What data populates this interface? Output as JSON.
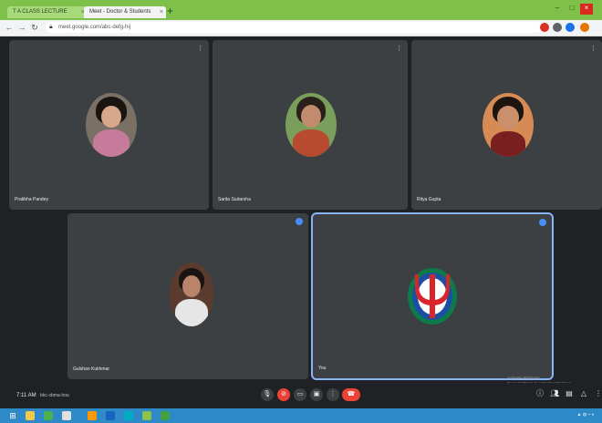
{
  "browser": {
    "tabs": [
      {
        "label": "T A CLASS LECTURE",
        "active": false
      },
      {
        "label": "Meet - Doctor & Students",
        "active": true
      }
    ],
    "url": "meet.google.com/abc-defg-hij"
  },
  "meeting": {
    "participants": [
      {
        "name": "Pratibha Pandey",
        "slot": "top-left"
      },
      {
        "name": "Sarita Sudarsha",
        "slot": "top-middle"
      },
      {
        "name": "Ritya Gupta",
        "slot": "top-right"
      },
      {
        "name": "Gulshan Kukhmar",
        "slot": "bottom-left"
      },
      {
        "name": "You",
        "slot": "bottom-right"
      }
    ],
    "time": "7:11 AM",
    "meeting_code": "bkc-xbma-hou",
    "activation_notice": [
      "Activate Windows",
      "Go to Settings to activate Windows."
    ]
  },
  "icons": {
    "more": "more-vert-icon",
    "mic": "mic-icon",
    "camera": "camera-icon",
    "captions": "captions-icon",
    "present": "present-icon",
    "raise_hand": "raise-hand-icon",
    "end_call": "end-call-icon",
    "info": "info-icon",
    "people": "people-icon",
    "chat": "chat-icon",
    "activities": "activities-icon"
  }
}
